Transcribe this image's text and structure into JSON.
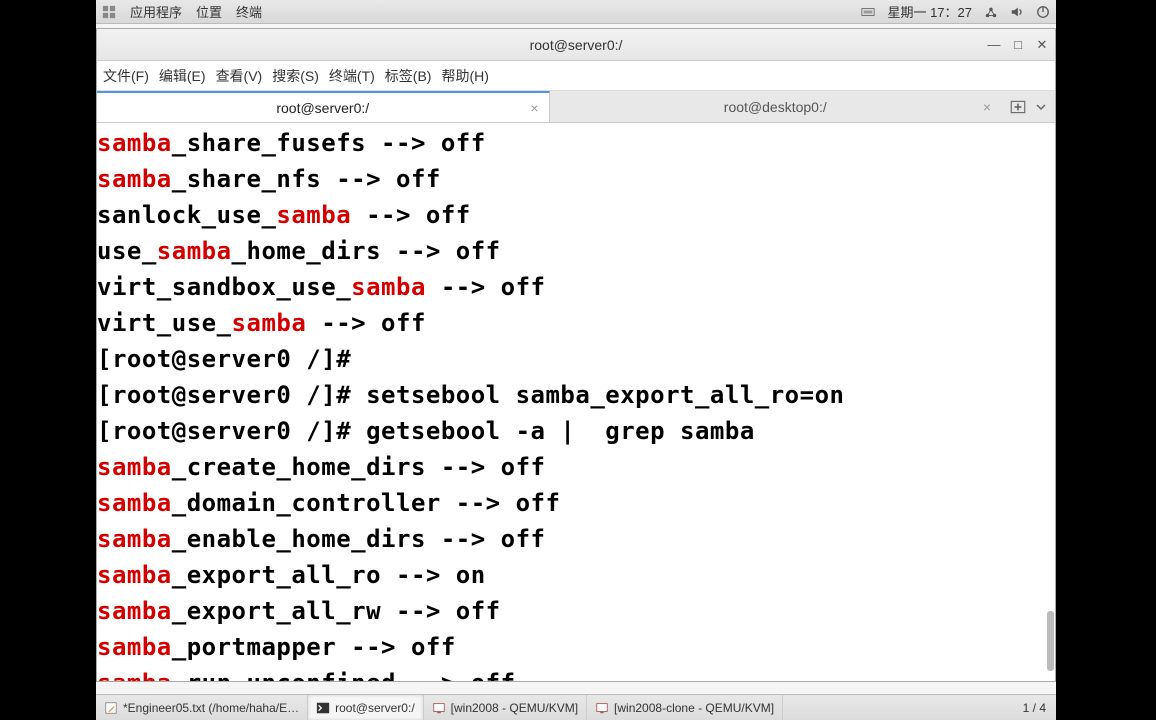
{
  "topbar": {
    "apps": "应用程序",
    "places": "位置",
    "terminal": "终端",
    "datetime": "星期一 17：27"
  },
  "window": {
    "title": "root@server0:/"
  },
  "menu": {
    "file": "文件(F)",
    "edit": "编辑(E)",
    "view": "查看(V)",
    "search": "搜索(S)",
    "terminal": "终端(T)",
    "tabs": "标签(B)",
    "help": "帮助(H)"
  },
  "tabs": {
    "t1": "root@server0:/",
    "t2": "root@desktop0:/"
  },
  "term": {
    "l1a": "samba",
    "l1b": "_share_fusefs --> off",
    "l2a": "samba",
    "l2b": "_share_nfs --> off",
    "l3a": "sanlock_use_",
    "l3b": "samba",
    "l3c": " --> off",
    "l4a": "use_",
    "l4b": "samba",
    "l4c": "_home_dirs --> off",
    "l5a": "virt_sandbox_use_",
    "l5b": "samba",
    "l5c": " --> off",
    "l6a": "virt_use_",
    "l6b": "samba",
    "l6c": " --> off",
    "l7": "[root@server0 /]# ",
    "l8": "[root@server0 /]# setsebool samba_export_all_ro=on",
    "l9": "[root@server0 /]# getsebool -a |  grep samba",
    "l10a": "samba",
    "l10b": "_create_home_dirs --> off",
    "l11a": "samba",
    "l11b": "_domain_controller --> off",
    "l12a": "samba",
    "l12b": "_enable_home_dirs --> off",
    "l13a": "samba",
    "l13b": "_export_all_ro --> on",
    "l14a": "samba",
    "l14b": "_export_all_rw --> off",
    "l15a": "samba",
    "l15b": "_portmapper --> off",
    "l16a": "samba",
    "l16b": "_run_unconfined --> off"
  },
  "taskbar": {
    "task1": "*Engineer05.txt (/home/haha/E…",
    "task2": "root@server0:/",
    "task3": "[win2008 - QEMU/KVM]",
    "task4": "[win2008-clone - QEMU/KVM]",
    "pager": "1 / 4"
  }
}
